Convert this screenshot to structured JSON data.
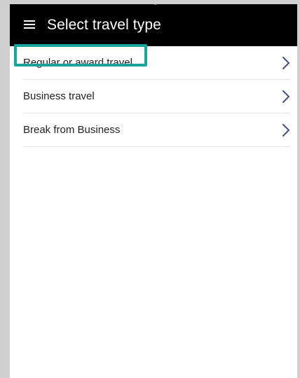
{
  "app_bar": {
    "title": "Select travel type"
  },
  "icons": {
    "menu": "hamburger-menu-icon",
    "chevron": "chevron-right-icon"
  },
  "colors": {
    "app_bar_bg": "#000000",
    "chevron": "#4b4f8c",
    "highlight": "#1aa39a"
  },
  "travel_types": [
    {
      "label": "Regular or award travel"
    },
    {
      "label": "Business travel"
    },
    {
      "label": "Break from Business"
    }
  ]
}
